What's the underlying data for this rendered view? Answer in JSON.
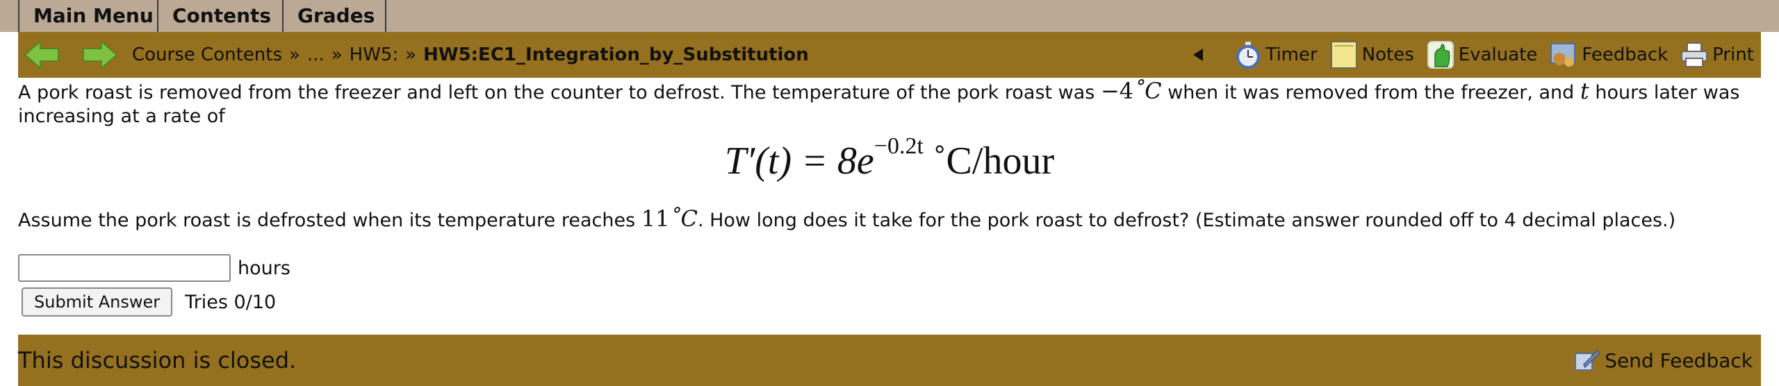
{
  "menu": {
    "tabs": [
      "Main Menu",
      "Contents",
      "Grades"
    ]
  },
  "nav": {
    "breadcrumb": {
      "root": "Course Contents",
      "ellipsis": "...",
      "folder": "HW5:",
      "current": "HW5:EC1_Integration_by_Substitution",
      "separator": "»"
    },
    "tools": {
      "timer": "Timer",
      "notes": "Notes",
      "evaluate": "Evaluate",
      "feedback": "Feedback",
      "print": "Print"
    }
  },
  "problem": {
    "intro_a": "A pork roast is removed from the freezer and left on the counter to defrost. The temperature of the pork roast was ",
    "initial_temp": "−4",
    "degree_unit": "˚C",
    "intro_b": " when it was removed from the freezer, and ",
    "var_t": "t",
    "intro_c": " hours later was increasing at a rate of",
    "formula_lhs": "T′(t) = 8e",
    "formula_exp": "−0.2t",
    "formula_unit": " ˚C/hour",
    "q_a": "Assume the pork roast is defrosted when its temperature reaches ",
    "target_temp": "11",
    "target_unit": "˚C",
    "q_b": ". How long does it take for the pork roast to defrost? (Estimate answer rounded off to 4 decimal places.)"
  },
  "answer": {
    "value": "",
    "unit": "hours",
    "submit_label": "Submit Answer",
    "tries": "Tries 0/10"
  },
  "discussion": {
    "status": "This discussion is closed.",
    "send_feedback": "Send Feedback"
  },
  "colors": {
    "menu_bg": "#bba995",
    "bar_bg": "#95701f",
    "arrow_green": "#7fc242"
  }
}
